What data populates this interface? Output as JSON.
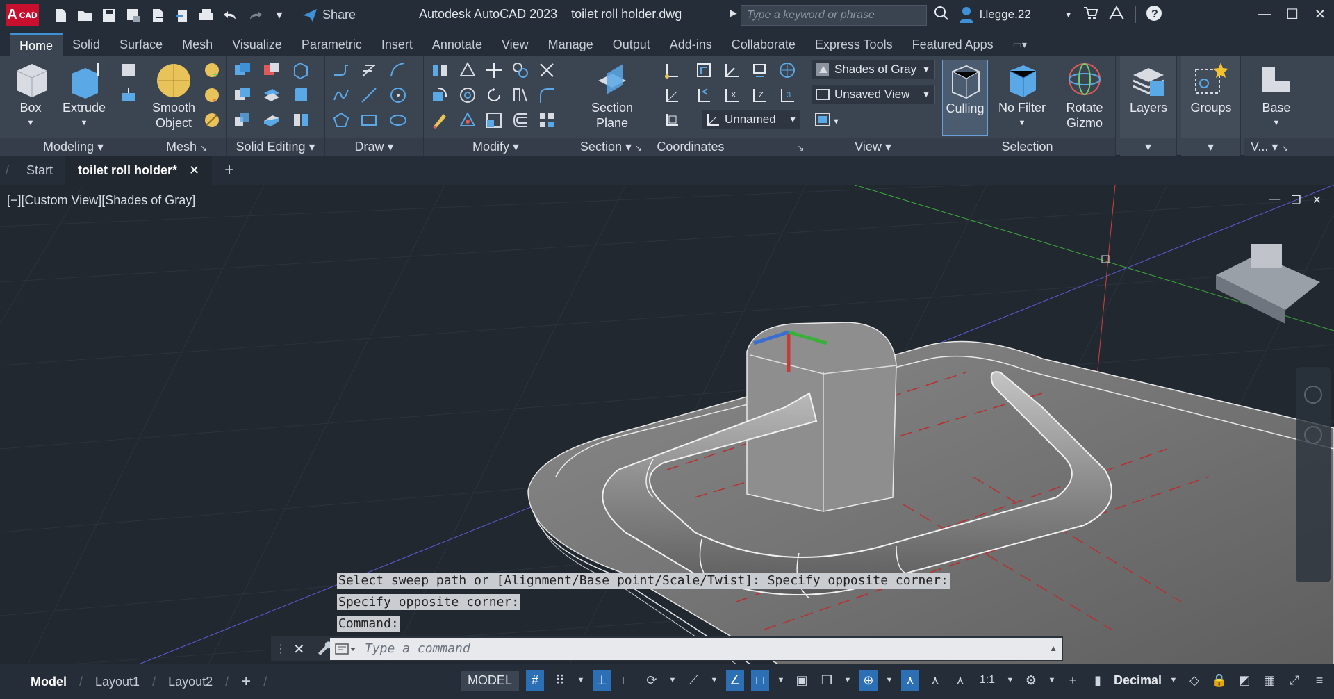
{
  "app": {
    "logo_letter": "A",
    "logo_text": "CAD",
    "title": "Autodesk AutoCAD 2023",
    "file": "toilet roll holder.dwg",
    "share_label": "Share",
    "search_placeholder": "Type a keyword or phrase",
    "user": "l.legge.22"
  },
  "menu_tabs": [
    "Home",
    "Solid",
    "Surface",
    "Mesh",
    "Visualize",
    "Parametric",
    "Insert",
    "Annotate",
    "View",
    "Manage",
    "Output",
    "Add-ins",
    "Collaborate",
    "Express Tools",
    "Featured Apps"
  ],
  "ribbon": {
    "modeling": {
      "label": "Modeling",
      "box": "Box",
      "extrude": "Extrude"
    },
    "mesh": {
      "label": "Mesh",
      "smooth_line1": "Smooth",
      "smooth_line2": "Object"
    },
    "solid_editing": {
      "label": "Solid Editing"
    },
    "draw": {
      "label": "Draw"
    },
    "modify": {
      "label": "Modify"
    },
    "section": {
      "label": "Section",
      "btn_line1": "Section",
      "btn_line2": "Plane"
    },
    "coordinates": {
      "label": "Coordinates",
      "ucs_name": "Unnamed"
    },
    "view": {
      "label": "View",
      "visual_style": "Shades of Gray",
      "saved_view": "Unsaved View"
    },
    "selection": {
      "label": "Selection",
      "culling": "Culling",
      "no_filter": "No Filter",
      "rotate_line1": "Rotate",
      "rotate_line2": "Gizmo"
    },
    "layers": {
      "label": "Layers"
    },
    "groups": {
      "label": "Groups"
    },
    "base": {
      "label": "Base",
      "panel_label": "V..."
    }
  },
  "file_tabs": {
    "start": "Start",
    "active": "toilet roll holder*"
  },
  "viewport": {
    "label": "[−][Custom View][Shades of Gray]"
  },
  "command": {
    "history": [
      "Select sweep path or [Alignment/Base point/Scale/Twist]: Specify opposite corner:",
      "Specify opposite corner:",
      "Command:"
    ],
    "placeholder": "Type a command"
  },
  "status": {
    "tabs": [
      "Model",
      "Layout1",
      "Layout2"
    ],
    "model_label": "MODEL",
    "scale": "1:1",
    "units": "Decimal"
  },
  "colors": {
    "accent": "#2d6fb4",
    "brand": "#c8102e",
    "ribbon": "#3b4451"
  }
}
